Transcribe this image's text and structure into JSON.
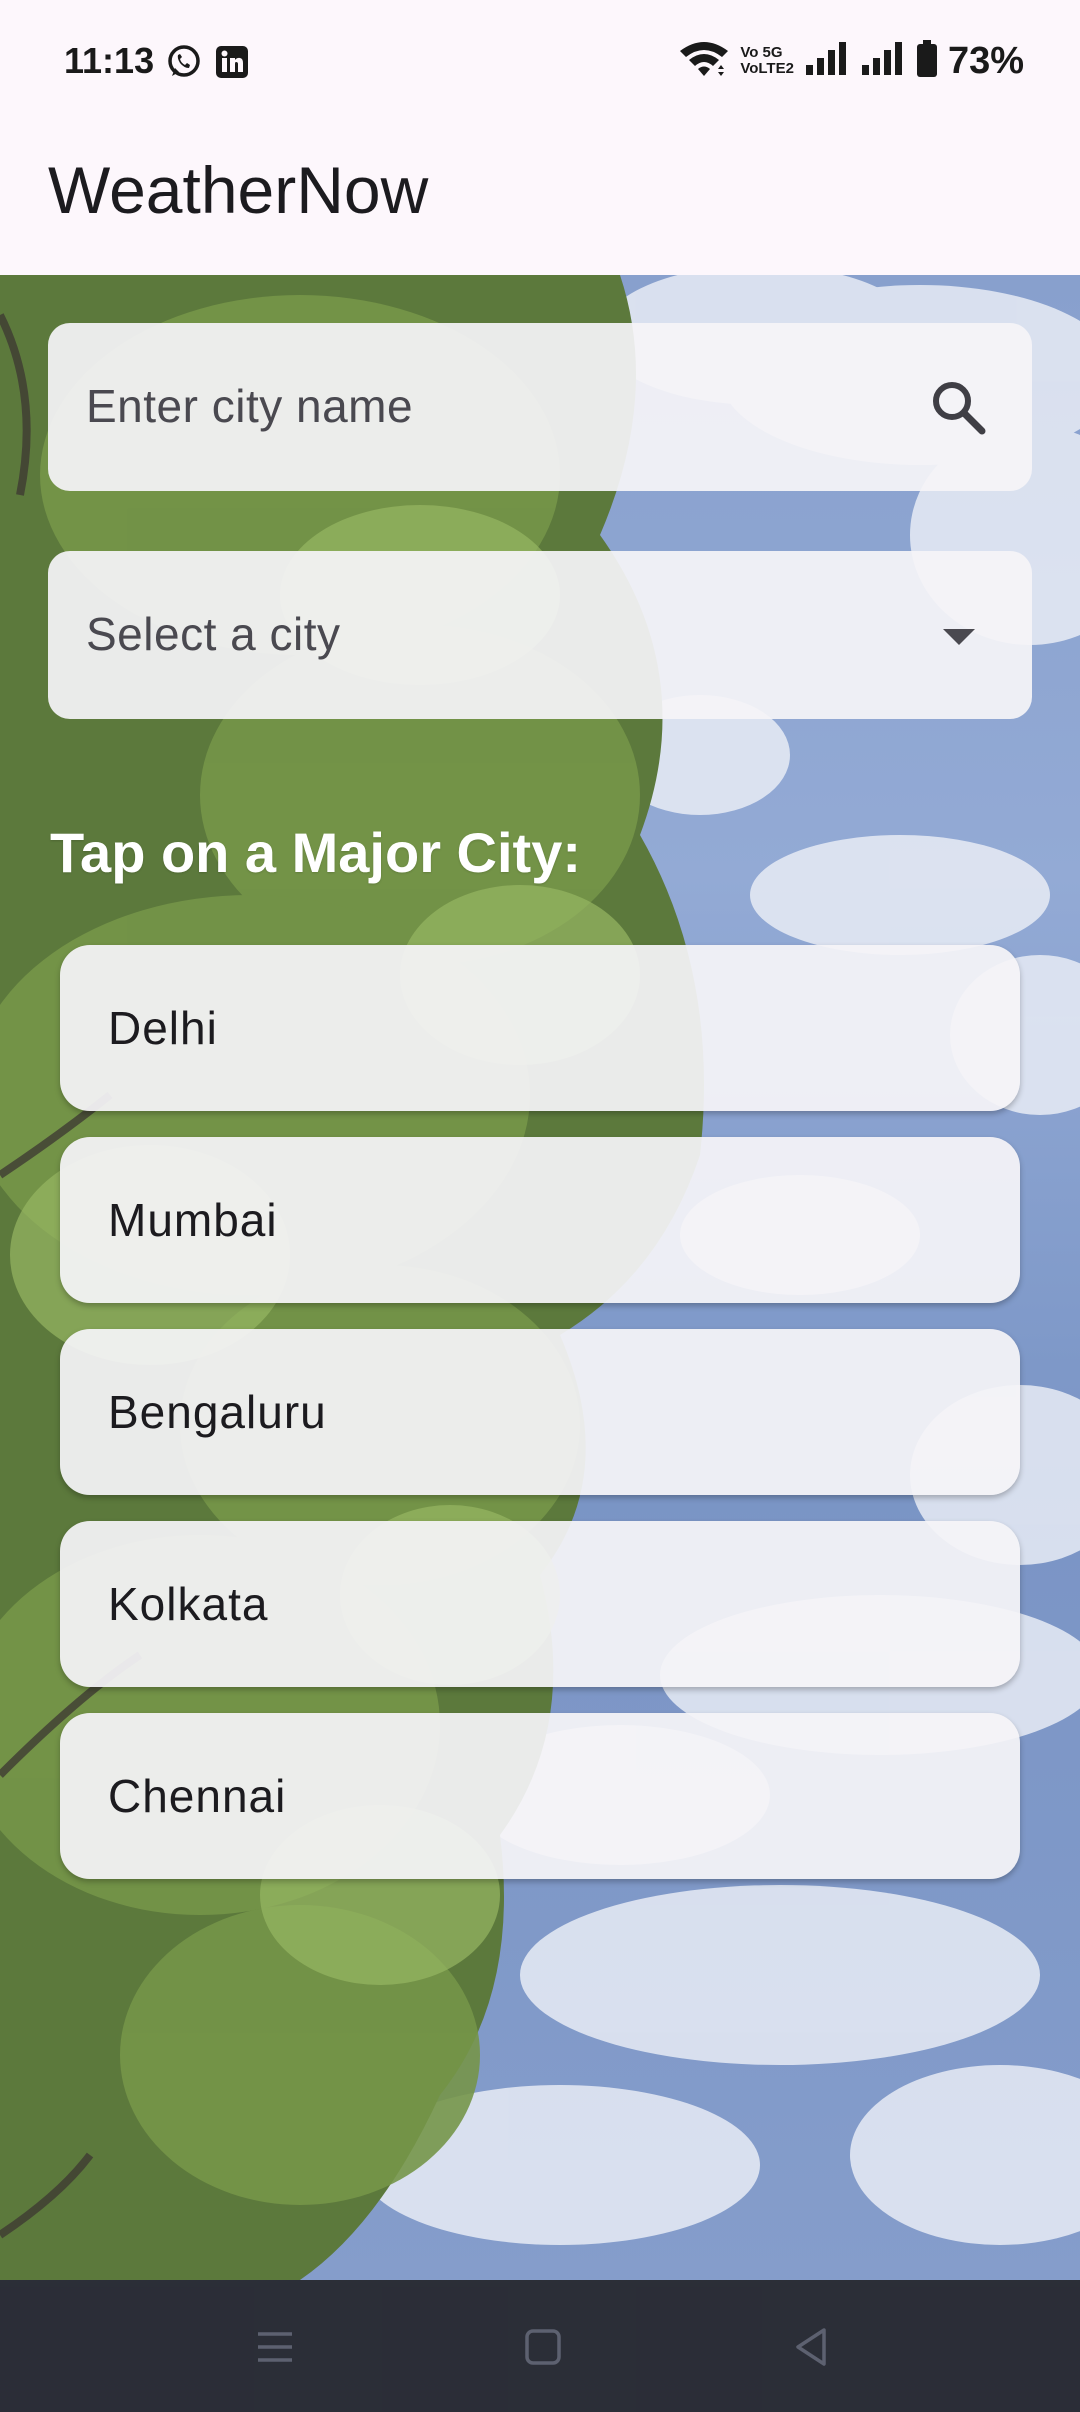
{
  "status_bar": {
    "time": "11:13",
    "left_icons": [
      "whatsapp-icon",
      "linkedin-icon"
    ],
    "right_icons": [
      "wifi-icon",
      "volte-icon",
      "signal-icon",
      "signal-icon",
      "battery-icon"
    ],
    "network_label_top": "Vo 5G",
    "network_label_bottom": "VoLTE2",
    "battery": "73%"
  },
  "app_bar": {
    "title": "WeatherNow"
  },
  "search": {
    "placeholder": "Enter city name",
    "icon": "search-icon"
  },
  "city_select": {
    "placeholder": "Select a city",
    "icon": "dropdown-arrow-icon"
  },
  "major_cities": {
    "heading": "Tap on a Major City:",
    "items": [
      {
        "label": "Delhi"
      },
      {
        "label": "Mumbai"
      },
      {
        "label": "Bengaluru"
      },
      {
        "label": "Kolkata"
      },
      {
        "label": "Chennai"
      }
    ]
  },
  "nav_bar": {
    "icons": [
      "menu-icon",
      "home-icon",
      "back-icon"
    ]
  },
  "colors": {
    "app_background": "#fdf7fc",
    "card_background": "#f5f4f8",
    "heading_text": "#ffffff",
    "nav_bar": "#191c26"
  }
}
